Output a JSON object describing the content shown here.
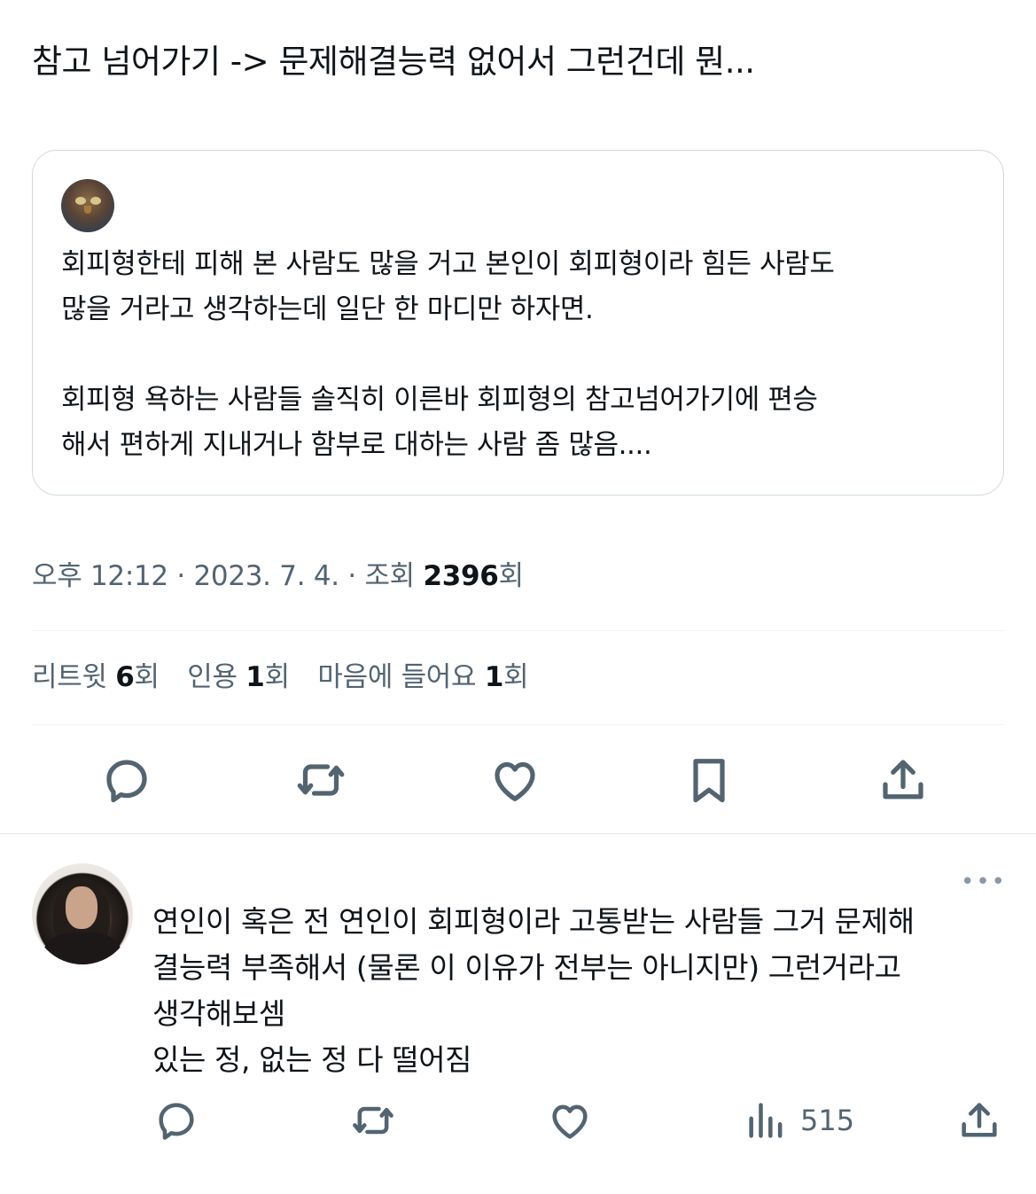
{
  "tweet": {
    "text": "참고 넘어가기 -> 문제해결능력 없어서 그런건데 뭔..."
  },
  "quoted_tweet": {
    "paragraph1_line1": "회피형한테 피해 본 사람도 많을 거고 본인이 회피형이라 힘든 사람도",
    "paragraph1_line2": "많을 거라고 생각하는데 일단 한 마디만 하자면.",
    "paragraph2_line1": "회피형 욕하는 사람들 솔직히 이른바 회피형의 참고넘어가기에 편승",
    "paragraph2_line2": "해서 편하게 지내거나 함부로 대하는 사람 좀 많음...."
  },
  "meta": {
    "time_date": "오후 12:12 · 2023. 7. 4. · 조회 ",
    "views": "2396",
    "views_suffix": "회"
  },
  "stats": {
    "retweets_label": "리트윗 ",
    "retweets_count": "6",
    "retweets_suffix": "회",
    "quotes_label": "인용 ",
    "quotes_count": "1",
    "quotes_suffix": "회",
    "likes_label": "마음에 들어요 ",
    "likes_count": "1",
    "likes_suffix": "회"
  },
  "actions": {
    "icons": [
      "reply-icon",
      "retweet-icon",
      "like-icon",
      "bookmark-icon",
      "share-icon"
    ]
  },
  "reply": {
    "more_label": "•••",
    "line1": "연인이 혹은 전 연인이 회피형이라 고통받는 사람들 그거 문제해",
    "line2": "결능력 부족해서 (물론 이 이유가 전부는 아니지만) 그런거라고",
    "line3": "생각해보셈",
    "line4": "있는 정, 없는 정 다 떨어짐",
    "views_count": "515",
    "icons": [
      "reply-icon",
      "retweet-icon",
      "like-icon",
      "views-icon",
      "share-icon"
    ]
  },
  "colors": {
    "text_primary": "#0f1419",
    "text_secondary": "#536471",
    "border": "#cfd9de"
  }
}
